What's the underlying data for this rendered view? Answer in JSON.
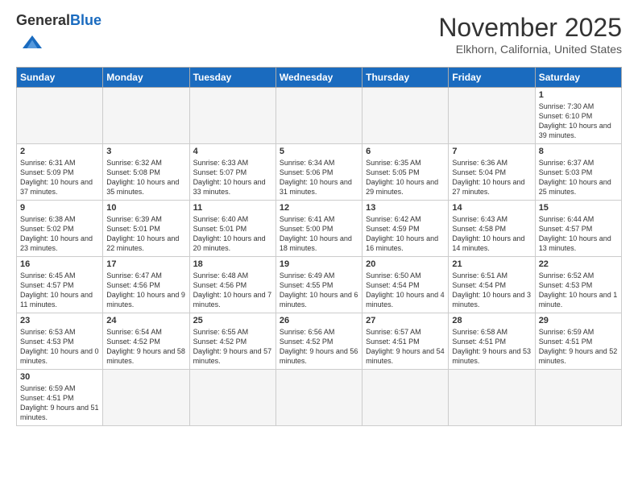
{
  "header": {
    "logo_line1": "General",
    "logo_line2": "Blue",
    "month_title": "November 2025",
    "location": "Elkhorn, California, United States"
  },
  "days_of_week": [
    "Sunday",
    "Monday",
    "Tuesday",
    "Wednesday",
    "Thursday",
    "Friday",
    "Saturday"
  ],
  "weeks": [
    [
      {
        "day": "",
        "text": ""
      },
      {
        "day": "",
        "text": ""
      },
      {
        "day": "",
        "text": ""
      },
      {
        "day": "",
        "text": ""
      },
      {
        "day": "",
        "text": ""
      },
      {
        "day": "",
        "text": ""
      },
      {
        "day": "1",
        "text": "Sunrise: 7:30 AM\nSunset: 6:10 PM\nDaylight: 10 hours\nand 39 minutes."
      }
    ],
    [
      {
        "day": "2",
        "text": "Sunrise: 6:31 AM\nSunset: 5:09 PM\nDaylight: 10 hours\nand 37 minutes."
      },
      {
        "day": "3",
        "text": "Sunrise: 6:32 AM\nSunset: 5:08 PM\nDaylight: 10 hours\nand 35 minutes."
      },
      {
        "day": "4",
        "text": "Sunrise: 6:33 AM\nSunset: 5:07 PM\nDaylight: 10 hours\nand 33 minutes."
      },
      {
        "day": "5",
        "text": "Sunrise: 6:34 AM\nSunset: 5:06 PM\nDaylight: 10 hours\nand 31 minutes."
      },
      {
        "day": "6",
        "text": "Sunrise: 6:35 AM\nSunset: 5:05 PM\nDaylight: 10 hours\nand 29 minutes."
      },
      {
        "day": "7",
        "text": "Sunrise: 6:36 AM\nSunset: 5:04 PM\nDaylight: 10 hours\nand 27 minutes."
      },
      {
        "day": "8",
        "text": "Sunrise: 6:37 AM\nSunset: 5:03 PM\nDaylight: 10 hours\nand 25 minutes."
      }
    ],
    [
      {
        "day": "9",
        "text": "Sunrise: 6:38 AM\nSunset: 5:02 PM\nDaylight: 10 hours\nand 23 minutes."
      },
      {
        "day": "10",
        "text": "Sunrise: 6:39 AM\nSunset: 5:01 PM\nDaylight: 10 hours\nand 22 minutes."
      },
      {
        "day": "11",
        "text": "Sunrise: 6:40 AM\nSunset: 5:01 PM\nDaylight: 10 hours\nand 20 minutes."
      },
      {
        "day": "12",
        "text": "Sunrise: 6:41 AM\nSunset: 5:00 PM\nDaylight: 10 hours\nand 18 minutes."
      },
      {
        "day": "13",
        "text": "Sunrise: 6:42 AM\nSunset: 4:59 PM\nDaylight: 10 hours\nand 16 minutes."
      },
      {
        "day": "14",
        "text": "Sunrise: 6:43 AM\nSunset: 4:58 PM\nDaylight: 10 hours\nand 14 minutes."
      },
      {
        "day": "15",
        "text": "Sunrise: 6:44 AM\nSunset: 4:57 PM\nDaylight: 10 hours\nand 13 minutes."
      }
    ],
    [
      {
        "day": "16",
        "text": "Sunrise: 6:45 AM\nSunset: 4:57 PM\nDaylight: 10 hours\nand 11 minutes."
      },
      {
        "day": "17",
        "text": "Sunrise: 6:47 AM\nSunset: 4:56 PM\nDaylight: 10 hours\nand 9 minutes."
      },
      {
        "day": "18",
        "text": "Sunrise: 6:48 AM\nSunset: 4:56 PM\nDaylight: 10 hours\nand 7 minutes."
      },
      {
        "day": "19",
        "text": "Sunrise: 6:49 AM\nSunset: 4:55 PM\nDaylight: 10 hours\nand 6 minutes."
      },
      {
        "day": "20",
        "text": "Sunrise: 6:50 AM\nSunset: 4:54 PM\nDaylight: 10 hours\nand 4 minutes."
      },
      {
        "day": "21",
        "text": "Sunrise: 6:51 AM\nSunset: 4:54 PM\nDaylight: 10 hours\nand 3 minutes."
      },
      {
        "day": "22",
        "text": "Sunrise: 6:52 AM\nSunset: 4:53 PM\nDaylight: 10 hours\nand 1 minute."
      }
    ],
    [
      {
        "day": "23",
        "text": "Sunrise: 6:53 AM\nSunset: 4:53 PM\nDaylight: 10 hours\nand 0 minutes."
      },
      {
        "day": "24",
        "text": "Sunrise: 6:54 AM\nSunset: 4:52 PM\nDaylight: 9 hours\nand 58 minutes."
      },
      {
        "day": "25",
        "text": "Sunrise: 6:55 AM\nSunset: 4:52 PM\nDaylight: 9 hours\nand 57 minutes."
      },
      {
        "day": "26",
        "text": "Sunrise: 6:56 AM\nSunset: 4:52 PM\nDaylight: 9 hours\nand 56 minutes."
      },
      {
        "day": "27",
        "text": "Sunrise: 6:57 AM\nSunset: 4:51 PM\nDaylight: 9 hours\nand 54 minutes."
      },
      {
        "day": "28",
        "text": "Sunrise: 6:58 AM\nSunset: 4:51 PM\nDaylight: 9 hours\nand 53 minutes."
      },
      {
        "day": "29",
        "text": "Sunrise: 6:59 AM\nSunset: 4:51 PM\nDaylight: 9 hours\nand 52 minutes."
      }
    ],
    [
      {
        "day": "30",
        "text": "Sunrise: 6:59 AM\nSunset: 4:51 PM\nDaylight: 9 hours\nand 51 minutes."
      },
      {
        "day": "",
        "text": ""
      },
      {
        "day": "",
        "text": ""
      },
      {
        "day": "",
        "text": ""
      },
      {
        "day": "",
        "text": ""
      },
      {
        "day": "",
        "text": ""
      },
      {
        "day": "",
        "text": ""
      }
    ]
  ]
}
